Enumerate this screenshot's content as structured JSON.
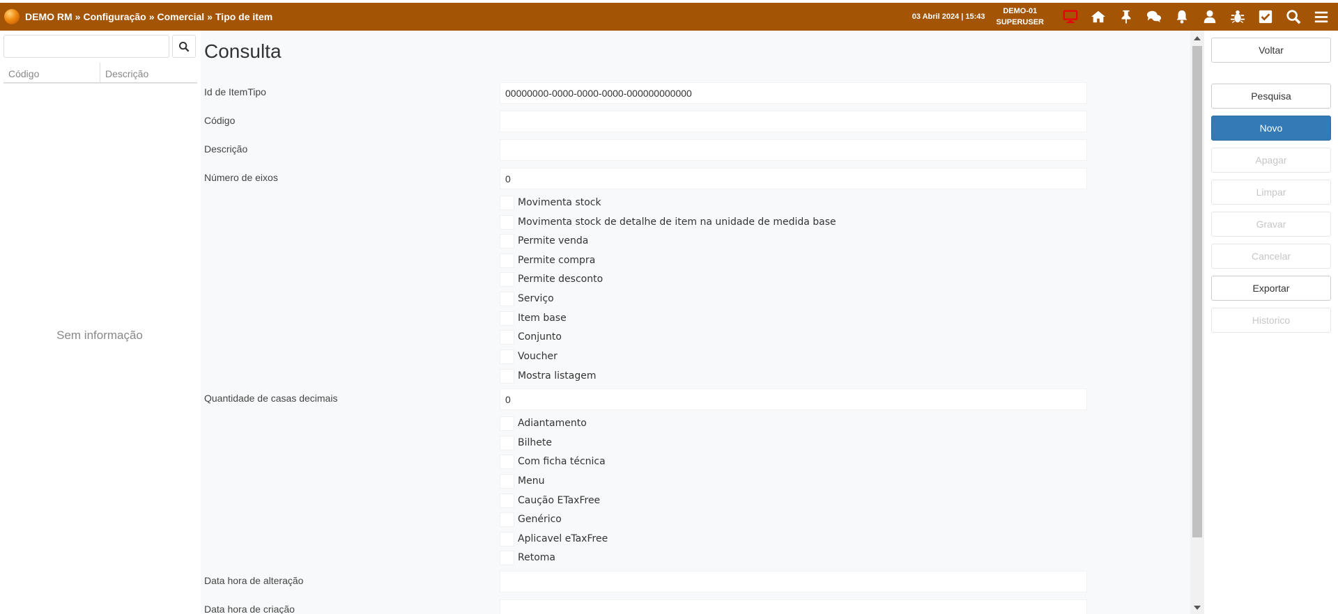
{
  "header": {
    "crumbs": [
      "DEMO RM",
      "»",
      "Configuração",
      "»",
      "Comercial",
      "»",
      "Tipo de item"
    ],
    "datetime": "03 Abril 2024 | 15:43",
    "company": "DEMO-01",
    "user": "SUPERUSER",
    "icons": [
      "monitor-icon",
      "home-icon",
      "pin-icon",
      "chat-icon",
      "bell-icon",
      "user-icon",
      "bug-icon",
      "checkbox-icon",
      "search-icon",
      "menu-icon"
    ],
    "brand_color": "#a35405",
    "monitor_color": "#e8000b"
  },
  "left": {
    "search_placeholder": "",
    "columns": [
      "Código",
      "Descrição"
    ],
    "empty_text": "Sem informação"
  },
  "form": {
    "title": "Consulta",
    "fields": {
      "id_label": "Id de ItemTipo",
      "id_value": "00000000-0000-0000-0000-000000000000",
      "codigo_label": "Código",
      "codigo_value": "",
      "descricao_label": "Descrição",
      "descricao_value": "",
      "eixos_label": "Número de eixos",
      "eixos_value": "0",
      "casas_label": "Quantidade de casas decimais",
      "casas_value": "0",
      "alteracao_label": "Data hora de alteração",
      "alteracao_value": "",
      "criacao_label": "Data hora de criação",
      "criacao_value": ""
    },
    "checks_a": [
      "Movimenta stock",
      "Movimenta stock de detalhe de item na unidade de medida base",
      "Permite venda",
      "Permite compra",
      "Permite desconto",
      "Serviço",
      "Item base",
      "Conjunto",
      "Voucher",
      "Mostra listagem"
    ],
    "checks_b": [
      "Adiantamento",
      "Bilhete",
      "Com ficha técnica",
      "Menu",
      "Caução ETaxFree",
      "Genérico",
      "Aplicavel eTaxFree",
      "Retoma"
    ]
  },
  "actions": {
    "voltar": "Voltar",
    "pesquisa": "Pesquisa",
    "novo": "Novo",
    "apagar": "Apagar",
    "limpar": "Limpar",
    "gravar": "Gravar",
    "cancelar": "Cancelar",
    "exportar": "Exportar",
    "historico": "Historico",
    "primary_color": "#337ab7"
  }
}
